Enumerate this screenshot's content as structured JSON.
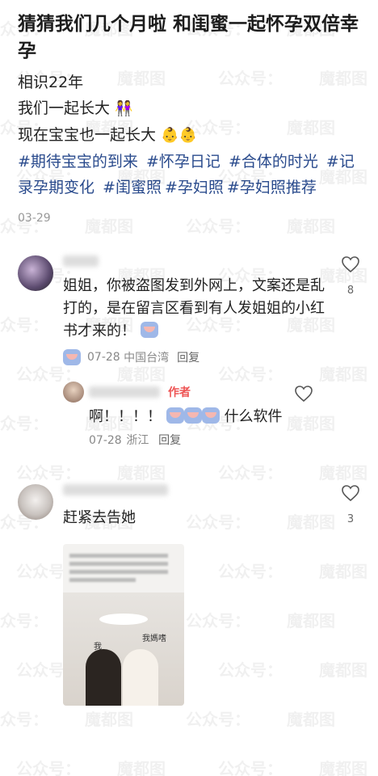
{
  "post": {
    "title": "猜猜我们几个月啦 和闺蜜一起怀孕双倍幸孕",
    "lines": [
      "相识22年",
      "我们一起长大",
      "现在宝宝也一起长大"
    ],
    "line_emojis": [
      "",
      "👭",
      "👶👶"
    ],
    "tags": [
      "#期待宝宝的到来",
      "#怀孕日记",
      "#合体的时光",
      "#记录孕期变化",
      "#闺蜜照",
      "#孕妇照",
      "#孕妇照推荐"
    ],
    "date": "03-29"
  },
  "comments": [
    {
      "text": "姐姐，你被盗图发到外网上，文案还是乱打的，是在留言区看到有人发姐姐的小红书才来的！",
      "sticker": "cry-sticker",
      "meta_date": "07-28",
      "meta_region": "中国台湾",
      "reply_label": "回复",
      "likes": "8"
    },
    {
      "badge": "作者",
      "text_prefix": "啊！！！！",
      "text_suffix": "什么软件",
      "meta_date": "07-28",
      "meta_region": "浙江",
      "reply_label": "回复",
      "likes": ""
    },
    {
      "text": "赶紧去告她",
      "likes": "3",
      "embed_labels": [
        "我",
        "我媽嗜"
      ]
    }
  ],
  "watermark": "公众号：",
  "watermark2": "魔都图"
}
